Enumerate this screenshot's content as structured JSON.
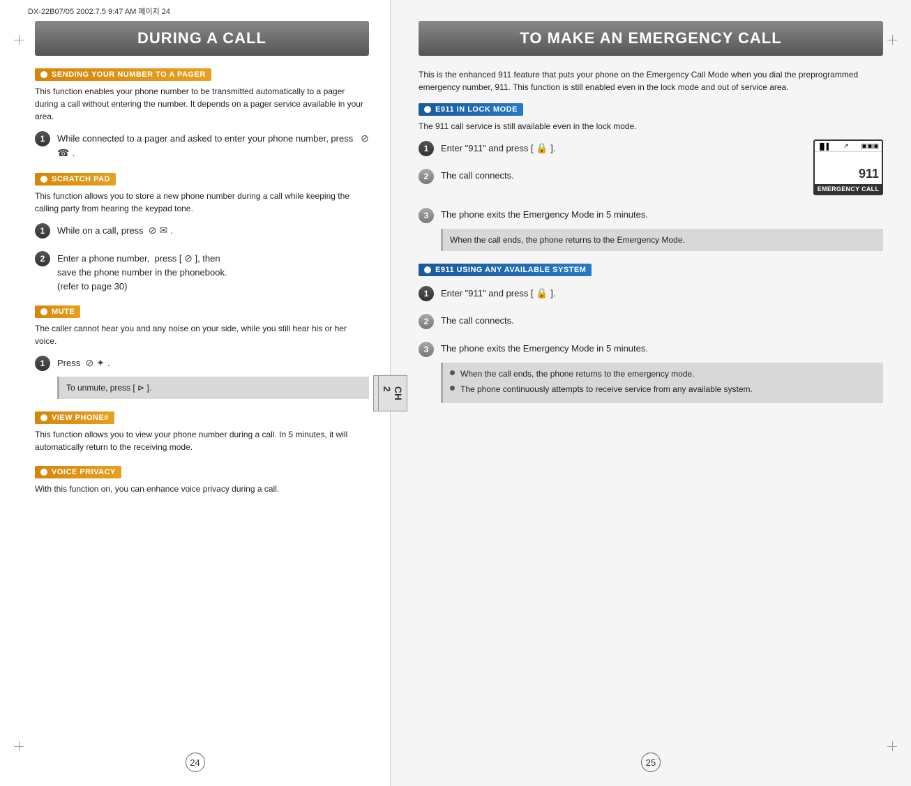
{
  "meta": {
    "doc_info": "DX-22B07/05  2002.7.5  9:47 AM  페이지 24"
  },
  "left_page": {
    "title": "DURING A CALL",
    "sections": [
      {
        "id": "sending",
        "header": "SENDING YOUR NUMBER TO A PAGER",
        "body": "This function enables your phone number to be transmitted automatically to a pager during a call without entering the number. It depends on a pager service available in your area.",
        "steps": [
          {
            "num": "1",
            "text": "While connected to a pager and asked to enter your phone number, press"
          }
        ]
      },
      {
        "id": "scratch",
        "header": "SCRATCH PAD",
        "body": "This function allows you to store a new phone number during a call while keeping the calling party from hearing the keypad tone.",
        "steps": [
          {
            "num": "1",
            "text": "While on a call, press"
          },
          {
            "num": "2",
            "text": "Enter a phone number,  press [ ☎ ], then save the phone number in the phonebook. (refer to page 30)"
          }
        ]
      },
      {
        "id": "mute",
        "header": "MUTE",
        "body": "The caller cannot hear you and any noise on your side, while you still hear his or her voice.",
        "steps": [
          {
            "num": "1",
            "text": "Press"
          }
        ],
        "note": "To unmute, press [ ⊳ ]."
      },
      {
        "id": "viewphone",
        "header": "VIEW PHONE#",
        "body": "This function allows you to view your phone number during a call. In 5 minutes, it will automatically return to the receiving mode."
      },
      {
        "id": "voiceprivacy",
        "header": "VOICE PRIVACY",
        "body": "With this function on, you can enhance voice privacy during a call."
      }
    ],
    "page_number": "24"
  },
  "right_page": {
    "title": "TO MAKE AN EMERGENCY CALL",
    "intro": "This is the enhanced 911 feature that puts your phone on the Emergency Call Mode when you dial the preprogrammed emergency number, 911. This function is still enabled even in the lock mode and out of service area.",
    "sections": [
      {
        "id": "e911lock",
        "header": "E911 IN LOCK MODE",
        "header_type": "blue",
        "body": "The 911 call service is still available even in the lock mode.",
        "steps": [
          {
            "num": "1",
            "text": "Enter \"911\" and press [ 🔒 ]."
          },
          {
            "num": "2",
            "text": "The call connects."
          },
          {
            "num": "3",
            "text": "The phone exits the Emergency Mode in 5 minutes."
          }
        ],
        "note": "When the call ends, the phone returns to the Emergency Mode.",
        "phone_screen": {
          "show": true,
          "number": "911",
          "bar_text": "EMERGENCY CALL"
        }
      },
      {
        "id": "e911any",
        "header": "E911 USING ANY AVAILABLE SYSTEM",
        "header_type": "blue",
        "steps": [
          {
            "num": "1",
            "text": "Enter \"911\" and press [ 🔒 ]."
          },
          {
            "num": "2",
            "text": "The call connects."
          },
          {
            "num": "3",
            "text": "The phone exits the Emergency Mode in 5 minutes."
          }
        ],
        "notes": [
          "When the call ends, the phone returns to the emergency mode.",
          "The phone continuously attempts to receive service from any available system."
        ]
      }
    ],
    "page_number": "25"
  },
  "ch_label": "CH\n2"
}
